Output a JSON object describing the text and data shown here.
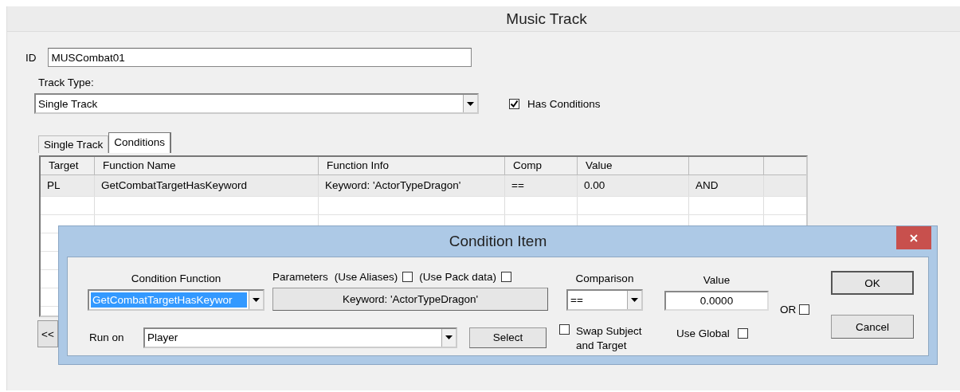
{
  "window": {
    "title": "Music Track"
  },
  "id_field": {
    "label": "ID",
    "value": "MUSCombat01"
  },
  "track_type": {
    "label": "Track Type:",
    "value": "Single Track"
  },
  "has_conditions": {
    "label": "Has Conditions",
    "checked": true
  },
  "tabs": [
    {
      "label": "Single Track",
      "selected": false
    },
    {
      "label": "Conditions",
      "selected": true
    }
  ],
  "table": {
    "columns": [
      "Target",
      "Function Name",
      "Function Info",
      "Comp",
      "Value"
    ],
    "rows": [
      {
        "target": "PL",
        "function_name": "GetCombatTargetHasKeyword",
        "function_info": "Keyword: 'ActorTypeDragon'",
        "comp": "==",
        "value": "0.00",
        "column_6": "AND"
      }
    ]
  },
  "scroll_button": {
    "label": "<<"
  },
  "dialog": {
    "title": "Condition Item",
    "condition_function": {
      "label": "Condition Function",
      "value": "GetCombatTargetHasKeywor"
    },
    "parameters": {
      "label": "Parameters",
      "use_aliases": {
        "label": "(Use Aliases)",
        "checked": false
      },
      "use_pack_data": {
        "label": "(Use Pack data)",
        "checked": false
      },
      "button": "Keyword: 'ActorTypeDragon'"
    },
    "comparison": {
      "label": "Comparison",
      "value": "=="
    },
    "value": {
      "label": "Value",
      "value": "0.0000"
    },
    "or": {
      "label": "OR",
      "checked": false
    },
    "run_on": {
      "label": "Run on",
      "value": "Player"
    },
    "select_button": "Select",
    "swap": {
      "label": "Swap Subject and Target",
      "checked": false
    },
    "use_global": {
      "label": "Use Global",
      "checked": false
    },
    "buttons": [
      "OK",
      "Cancel"
    ]
  }
}
